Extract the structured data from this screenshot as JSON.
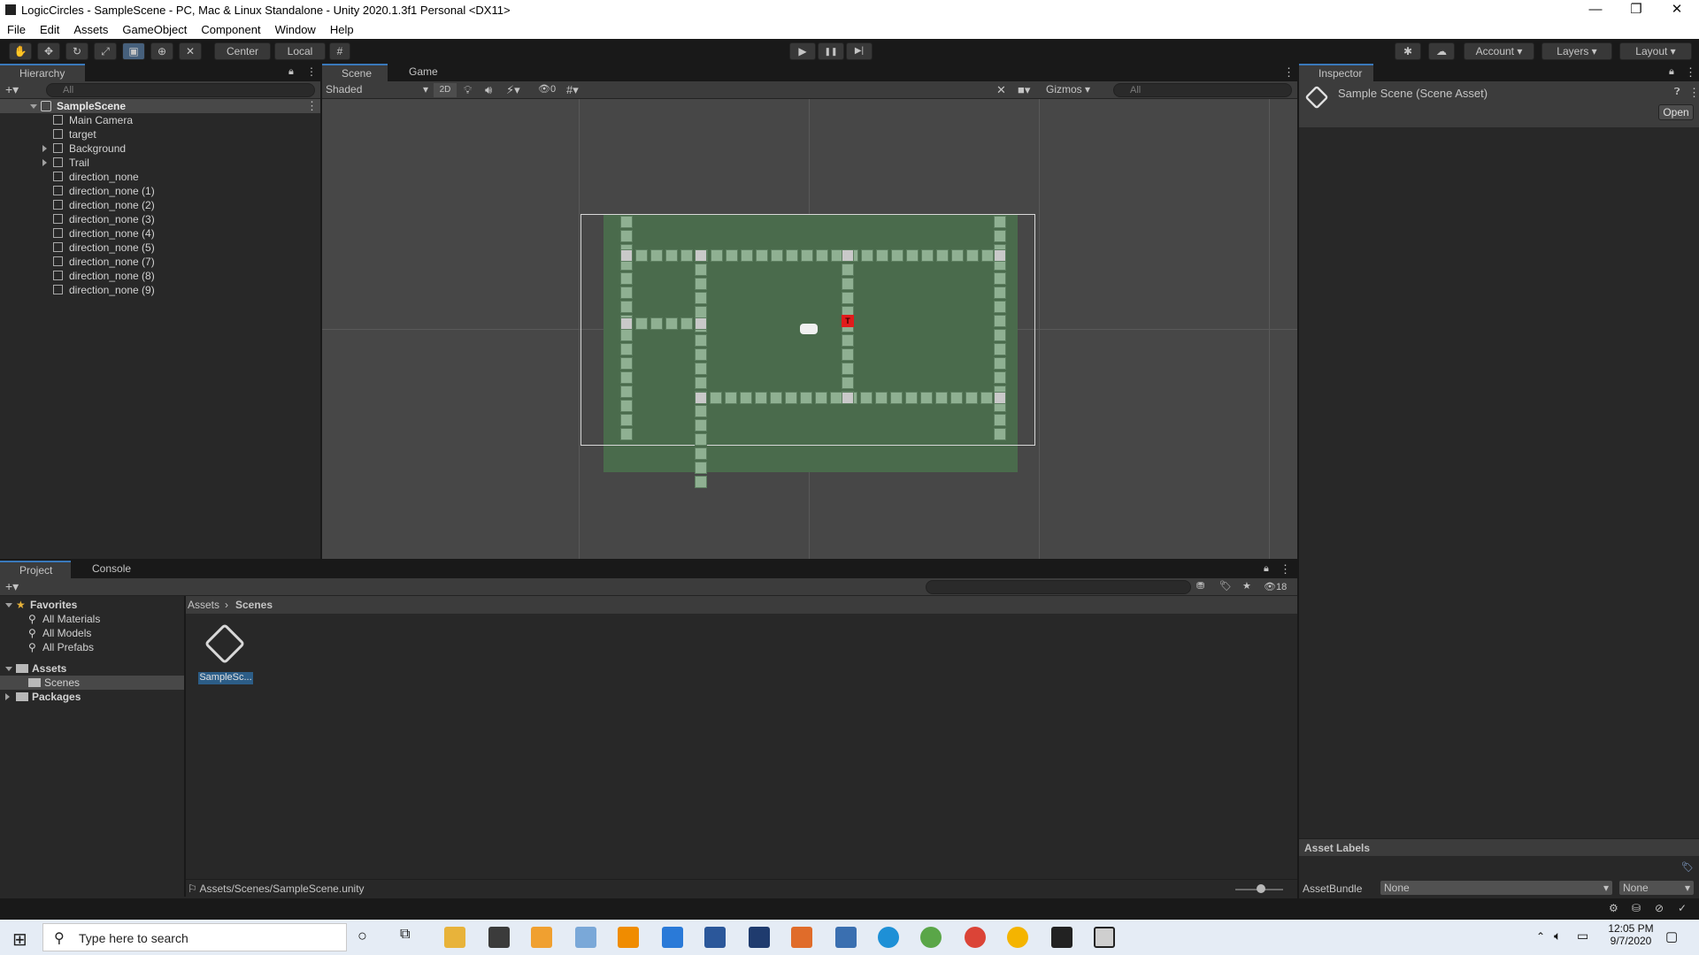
{
  "window": {
    "title": "LogicCircles - SampleScene - PC, Mac & Linux Standalone - Unity 2020.1.3f1 Personal <DX11>",
    "minimize": "—",
    "restore": "❐",
    "close": "✕"
  },
  "menu": [
    "File",
    "Edit",
    "Assets",
    "GameObject",
    "Component",
    "Window",
    "Help"
  ],
  "toolbar": {
    "pivot": "Center",
    "space": "Local",
    "play": "▶",
    "pause": "❚❚",
    "step": "▶|",
    "account": "Account",
    "layers": "Layers",
    "layout": "Layout"
  },
  "hierarchy": {
    "tab": "Hierarchy",
    "search_placeholder": "All",
    "scene": "SampleScene",
    "items": [
      {
        "label": "Main Camera",
        "foldout": false
      },
      {
        "label": "target",
        "foldout": false
      },
      {
        "label": "Background",
        "foldout": true
      },
      {
        "label": "Trail",
        "foldout": true
      },
      {
        "label": "direction_none",
        "foldout": false
      },
      {
        "label": "direction_none (1)",
        "foldout": false
      },
      {
        "label": "direction_none (2)",
        "foldout": false
      },
      {
        "label": "direction_none (3)",
        "foldout": false
      },
      {
        "label": "direction_none (4)",
        "foldout": false
      },
      {
        "label": "direction_none (5)",
        "foldout": false
      },
      {
        "label": "direction_none (7)",
        "foldout": false
      },
      {
        "label": "direction_none (8)",
        "foldout": false
      },
      {
        "label": "direction_none (9)",
        "foldout": false
      }
    ]
  },
  "scene": {
    "tabs": [
      "Scene",
      "Game"
    ],
    "shading": "Shaded",
    "mode_2d": "2D",
    "hidden_count": "0",
    "gizmos": "Gizmos",
    "search_placeholder": "All",
    "target_marker": "T"
  },
  "inspector": {
    "tab": "Inspector",
    "asset_title": "Sample Scene (Scene Asset)",
    "open_button": "Open",
    "asset_labels": "Asset Labels",
    "assetbundle_label": "AssetBundle",
    "assetbundle_value": "None",
    "variant_value": "None"
  },
  "project": {
    "tabs": [
      "Project",
      "Console"
    ],
    "favorites": "Favorites",
    "favorite_items": [
      "All Materials",
      "All Models",
      "All Prefabs"
    ],
    "assets": "Assets",
    "scenes": "Scenes",
    "packages": "Packages",
    "breadcrumb": [
      "Assets",
      "Scenes"
    ],
    "asset_file": "SampleSc...",
    "hidden_count": "18",
    "path": "Assets/Scenes/SampleScene.unity"
  },
  "taskbar": {
    "search_placeholder": "Type here to search",
    "time": "12:05 PM",
    "date": "9/7/2020"
  },
  "colors": {
    "accent": "#3a79bb",
    "scene_bg": "#474747",
    "board": "#4a6b4c",
    "tile": "#8fb092",
    "node": "#c9c9c9",
    "target": "#e01b1b"
  }
}
